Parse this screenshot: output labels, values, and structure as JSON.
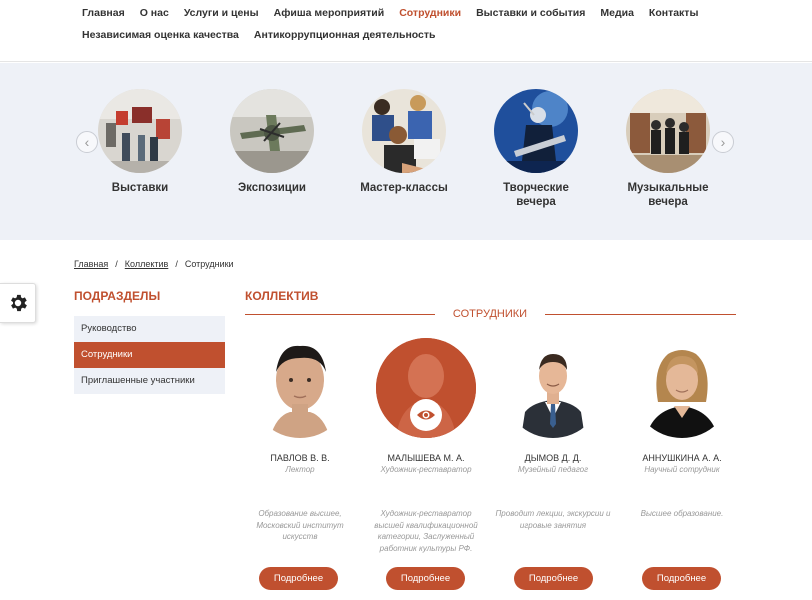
{
  "nav": {
    "row1": [
      "Главная",
      "О нас",
      "Услуги и цены",
      "Афиша мероприятий",
      "Сотрудники",
      "Выставки и события",
      "Медиа",
      "Контакты"
    ],
    "row2": [
      "Независимая оценка качества",
      "Антикоррупционная деятельность"
    ],
    "active": "Сотрудники"
  },
  "categories": [
    {
      "label_line1": "Выставки",
      "label_line2": "",
      "icon": "exhibition-photo"
    },
    {
      "label_line1": "Экспозиции",
      "label_line2": "",
      "icon": "aircraft-exposition-photo"
    },
    {
      "label_line1": "Мастер-классы",
      "label_line2": "",
      "icon": "masterclass-photo"
    },
    {
      "label_line1": "Творческие",
      "label_line2": "вечера",
      "icon": "concert-photo"
    },
    {
      "label_line1": "Музыкальные",
      "label_line2": "вечера",
      "icon": "orchestra-photo"
    }
  ],
  "carousel": {
    "prev_glyph": "‹",
    "next_glyph": "›"
  },
  "breadcrumb": {
    "home": "Главная",
    "sep": "/",
    "collective": "Коллектив",
    "current": "Сотрудники"
  },
  "sidebar": {
    "title": "ПОДРАЗДЕЛЫ",
    "items": [
      "Руководство",
      "Сотрудники",
      "Приглашенные участники"
    ],
    "active_index": 1
  },
  "main": {
    "title": "КОЛЛЕКТИВ",
    "section": "СОТРУДНИКИ"
  },
  "staff": [
    {
      "name": "ПАВЛОВ В. В.",
      "role": "Лектор",
      "desc": "Образование высшее, Московский институт искусств",
      "button": "Подробнее"
    },
    {
      "name": "МАЛЫШЕВА М. А.",
      "role": "Художник-реставратор",
      "desc": "Художник-реставратор высшей квалификационной категории, Заслуженный работник культуры РФ.",
      "button": "Подробнее"
    },
    {
      "name": "ДЫМОВ Д. Д.",
      "role": "Музейный педагог",
      "desc": "Проводит лекции, экскурсии и игровые занятия",
      "button": "Подробнее"
    },
    {
      "name": "АННУШКИНА А. А.",
      "role": "Научный сотрудник",
      "desc": "Высшее образование.",
      "button": "Подробнее"
    }
  ],
  "colors": {
    "accent": "#c0502f",
    "panel": "#eef1f7"
  }
}
